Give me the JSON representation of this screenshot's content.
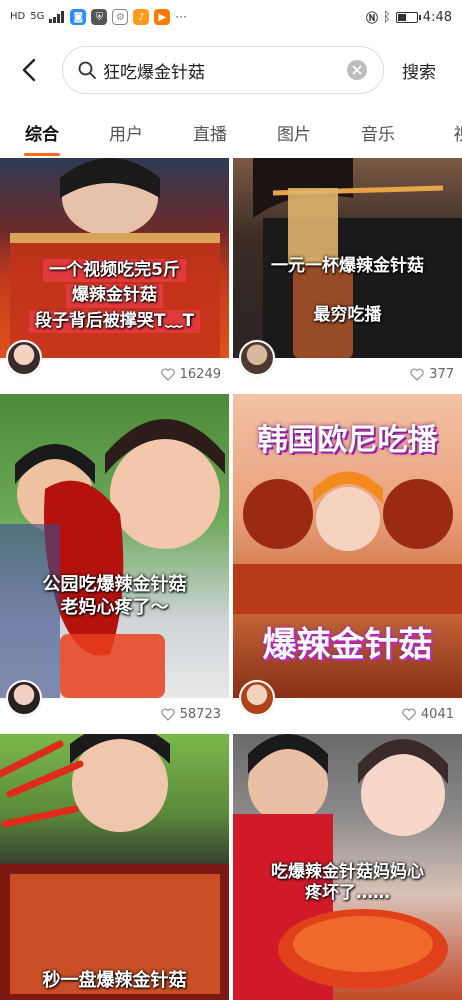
{
  "status_bar": {
    "left_label": "HD",
    "network": "5G",
    "time": "4:48",
    "battery_level": 0.45
  },
  "search": {
    "query": "狂吃爆金针菇",
    "submit_label": "搜索"
  },
  "tabs": [
    {
      "label": "综合",
      "active": true
    },
    {
      "label": "用户",
      "active": false
    },
    {
      "label": "直播",
      "active": false
    },
    {
      "label": "图片",
      "active": false
    },
    {
      "label": "音乐",
      "active": false
    },
    {
      "label": "视",
      "active": false
    }
  ],
  "cards": [
    {
      "caption_lines": [
        "一个视频吃完5斤",
        "爆辣金针菇",
        "段子背后被撑哭T﹏T"
      ],
      "likes": "16249"
    },
    {
      "caption_lines": [
        "一元一杯爆辣金针菇",
        "最穷吃播"
      ],
      "likes": "377"
    },
    {
      "caption_lines": [
        "公园吃爆辣金针菇",
        "老妈心疼了～"
      ],
      "likes": "58723"
    },
    {
      "caption_lines": [
        "韩国欧尼吃播",
        "爆辣金针菇"
      ],
      "likes": "4041"
    },
    {
      "caption_lines": [
        "秒一盘爆辣金针菇"
      ],
      "likes": ""
    },
    {
      "caption_lines": [
        "吃爆辣金针菇妈妈心",
        "疼坏了……"
      ],
      "likes": ""
    }
  ],
  "colors": {
    "accent": "#ff6a1a",
    "text": "#222222",
    "muted": "#666666"
  }
}
